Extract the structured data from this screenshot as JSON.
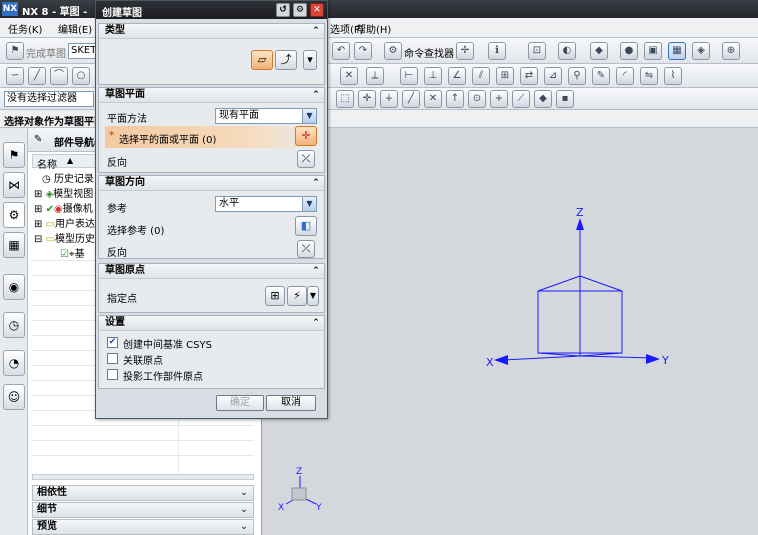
{
  "app": {
    "title": "NX 8 - 草图 -",
    "logo_text": "NX"
  },
  "menubar": {
    "items": [
      "任务(K)",
      "编辑(E)",
      "选项(P)",
      "帮助(H)"
    ]
  },
  "toolbar1": {
    "finish_label": "完成草图",
    "sketch_combo": "SKETC",
    "command_finder": "命令查找器"
  },
  "filter": {
    "value": "没有选择过滤器"
  },
  "status": {
    "prompt": "选择对象作为草图平面"
  },
  "navigator": {
    "title": "部件导航器",
    "column_name": "名称",
    "tree": [
      {
        "label": "历史记录"
      },
      {
        "label": "模型视图"
      },
      {
        "label": "摄像机"
      },
      {
        "label": "用户表达"
      },
      {
        "label": "模型历史"
      },
      {
        "label": "基"
      }
    ],
    "accordions": [
      "相依性",
      "细节",
      "预览"
    ]
  },
  "dialog": {
    "title": "创建草图",
    "type": {
      "header": "类型"
    },
    "plane": {
      "header": "草图平面",
      "method_label": "平面方法",
      "method_value": "现有平面",
      "select_label": "选择平的面或平面 (0)",
      "reverse_label": "反向"
    },
    "orientation": {
      "header": "草图方向",
      "ref_label": "参考",
      "ref_value": "水平",
      "select_ref_label": "选择参考 (0)",
      "reverse_label": "反向"
    },
    "origin": {
      "header": "草图原点",
      "point_label": "指定点"
    },
    "settings": {
      "header": "设置",
      "options": [
        {
          "label": "创建中间基准 CSYS",
          "checked": true
        },
        {
          "label": "关联原点",
          "checked": false
        },
        {
          "label": "投影工作部件原点",
          "checked": false
        }
      ]
    },
    "ok_label": "确定",
    "cancel_label": "取消"
  },
  "triad": {
    "x": "X",
    "y": "Y",
    "z": "Z"
  },
  "colors": {
    "axis": "#1a1aff",
    "highlight": "#f0c9a0",
    "required": "#e06000"
  }
}
